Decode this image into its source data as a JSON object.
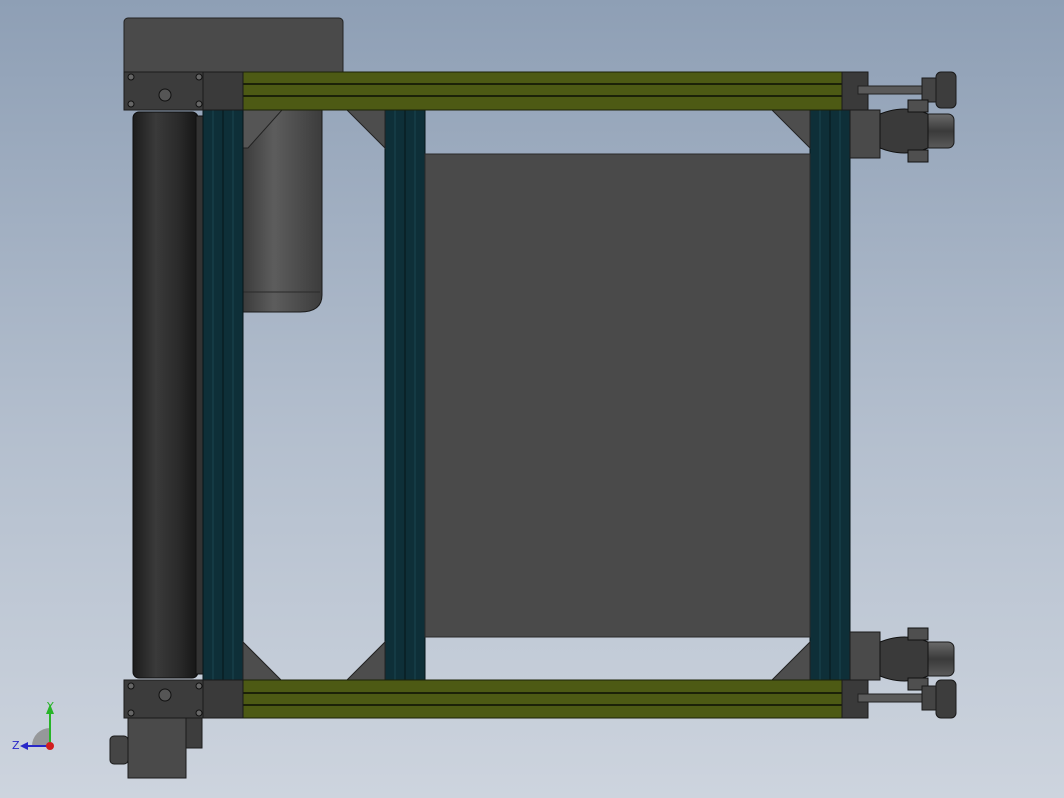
{
  "viewport": {
    "background_top": "#8e9fb5",
    "background_bottom": "#cdd4de"
  },
  "model": {
    "description_parts": [
      "motor-housing-top",
      "drive-roller",
      "side-frame-left",
      "side-frame-right",
      "cross-rail-top",
      "cross-rail-bottom",
      "center-panel",
      "caster-wheel-top",
      "caster-wheel-bottom",
      "leveling-foot-top",
      "leveling-foot-bottom",
      "gear-motor",
      "bottom-connector-box"
    ],
    "colors": {
      "frame_profile": "#0e2f38",
      "rail_green": "#4d5a14",
      "panel": "#4a4a4a",
      "roller": "#2b2b2b",
      "metal_dark": "#3d3d3d"
    }
  },
  "triad": {
    "y_label": "Y",
    "z_label": "Z",
    "y_color": "#28b428",
    "z_color": "#2828c8",
    "x_color": "#d21e1e"
  }
}
